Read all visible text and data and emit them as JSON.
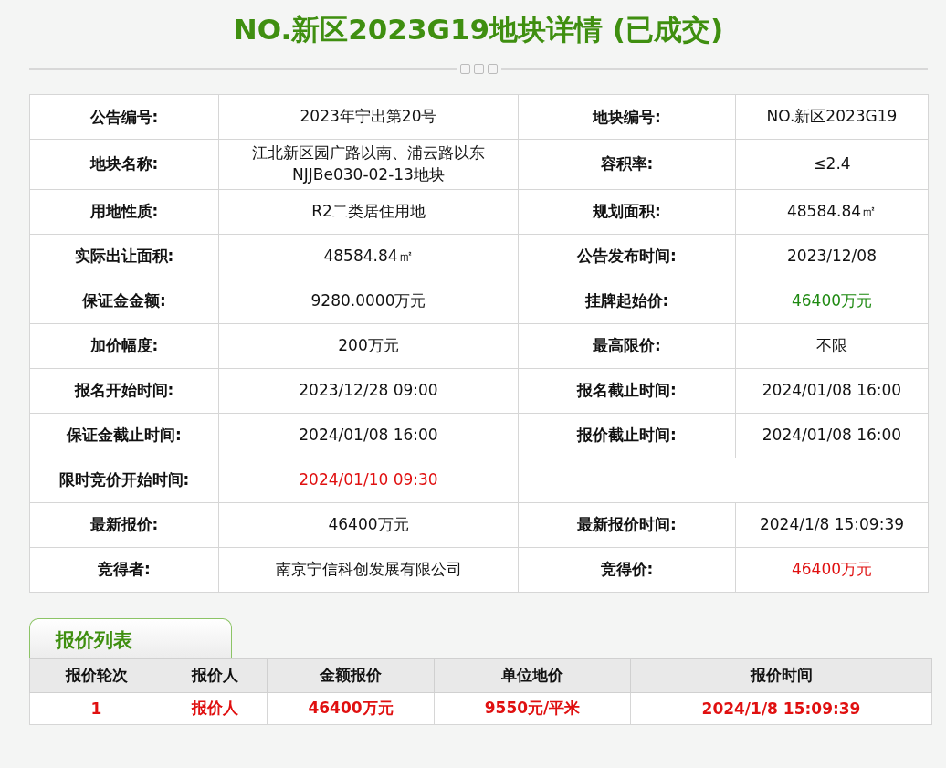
{
  "title": "NO.新区2023G19地块详情 (已成交)",
  "details": [
    [
      {
        "label": "公告编号:",
        "value": "2023年宁出第20号",
        "color": "#111111"
      },
      {
        "label": "地块编号:",
        "value": "NO.新区2023G19",
        "color": "#111111"
      }
    ],
    [
      {
        "label": "地块名称:",
        "value": "江北新区园广路以南、浦云路以东NJJBe030-02-13地块",
        "color": "#111111"
      },
      {
        "label": "容积率:",
        "value": "≤2.4",
        "color": "#111111"
      }
    ],
    [
      {
        "label": "用地性质:",
        "value": "R2二类居住用地",
        "color": "#111111"
      },
      {
        "label": "规划面积:",
        "value": "48584.84㎡",
        "color": "#111111"
      }
    ],
    [
      {
        "label": "实际出让面积:",
        "value": "48584.84㎡",
        "color": "#111111"
      },
      {
        "label": "公告发布时间:",
        "value": "2023/12/08",
        "color": "#111111"
      }
    ],
    [
      {
        "label": "保证金金额:",
        "value": "9280.0000万元",
        "color": "#111111"
      },
      {
        "label": "挂牌起始价:",
        "value": "46400万元",
        "color": "#1f8a12"
      }
    ],
    [
      {
        "label": "加价幅度:",
        "value": "200万元",
        "color": "#111111"
      },
      {
        "label": "最高限价:",
        "value": "不限",
        "color": "#111111"
      }
    ],
    [
      {
        "label": "报名开始时间:",
        "value": "2023/12/28 09:00",
        "color": "#111111"
      },
      {
        "label": "报名截止时间:",
        "value": "2024/01/08 16:00",
        "color": "#111111"
      }
    ],
    [
      {
        "label": "保证金截止时间:",
        "value": "2024/01/08 16:00",
        "color": "#111111"
      },
      {
        "label": "报价截止时间:",
        "value": "2024/01/08 16:00",
        "color": "#111111"
      }
    ],
    [
      {
        "label": "限时竞价开始时间:",
        "value": "2024/01/10 09:30",
        "color": "#e01010"
      }
    ],
    [
      {
        "label": "最新报价:",
        "value": "46400万元",
        "color": "#111111"
      },
      {
        "label": "最新报价时间:",
        "value": "2024/1/8 15:09:39",
        "color": "#111111"
      }
    ],
    [
      {
        "label": "竞得者:",
        "value": "南京宁信科创发展有限公司",
        "color": "#111111"
      },
      {
        "label": "竞得价:",
        "value": "46400万元",
        "color": "#e01010"
      }
    ]
  ],
  "bid_list": {
    "tab": "报价列表",
    "columns": [
      "报价轮次",
      "报价人",
      "金额报价",
      "单位地价",
      "报价时间"
    ],
    "rows": [
      [
        "1",
        "报价人",
        "46400万元",
        "9550元/平米",
        "2024/1/8 15:09:39"
      ]
    ]
  }
}
